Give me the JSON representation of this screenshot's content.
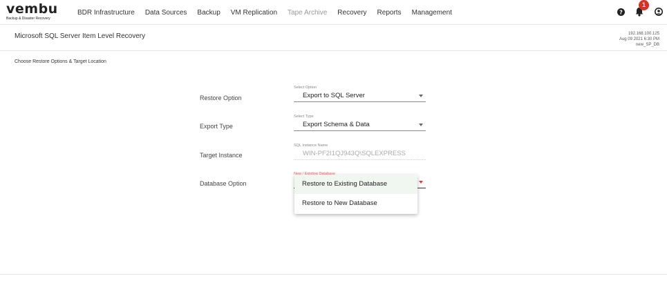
{
  "brand": {
    "name": "vembu",
    "tagline": "Backup & Disaster Recovery"
  },
  "nav": {
    "items": [
      {
        "label": "BDR Infrastructure"
      },
      {
        "label": "Data Sources"
      },
      {
        "label": "Backup"
      },
      {
        "label": "VM Replication"
      },
      {
        "label": "Tape Archive"
      },
      {
        "label": "Recovery"
      },
      {
        "label": "Reports"
      },
      {
        "label": "Management"
      }
    ],
    "notification_count": "1",
    "icons": [
      "help-icon",
      "bell-icon",
      "user-icon"
    ]
  },
  "page": {
    "title": "Microsoft SQL Server Item Level Recovery",
    "meta": {
      "ip": "192.168.100.125",
      "datetime": "Aug 09 2021 6:30 PM",
      "job": "new_SP_DB"
    },
    "section_title": "Choose Restore Options & Target Location"
  },
  "form": {
    "restore_option": {
      "label": "Restore Option",
      "caption": "Select Option",
      "value": "Export to SQL Server"
    },
    "export_type": {
      "label": "Export Type",
      "caption": "Select Type",
      "value": "Export Schema & Data"
    },
    "target_instance": {
      "label": "Target Instance",
      "caption": "SQL Instance Name",
      "value": "WIN-PF2I1QJ943Q\\SQLEXPRESS"
    },
    "database_option": {
      "label": "Database Option",
      "caption": "New / Existing Database",
      "value": ""
    }
  },
  "dropdown": {
    "options": [
      {
        "label": "Restore to Existing Database",
        "highlighted": true
      },
      {
        "label": "Restore to New Database",
        "highlighted": false
      }
    ]
  },
  "colors": {
    "badge": "#d93025",
    "error": "#e53935",
    "highlight": "#f0f6f0"
  }
}
